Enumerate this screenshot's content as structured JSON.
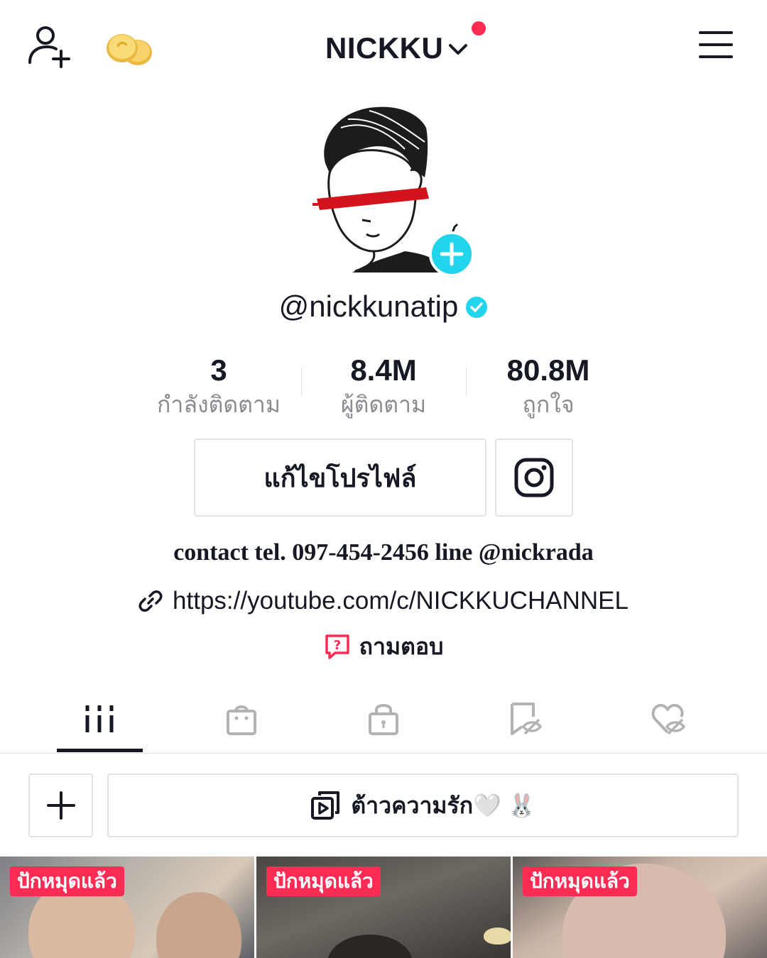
{
  "header": {
    "account_name": "NICKKU",
    "add_friend_icon": "person-add-icon",
    "coins_icon": "coins-icon",
    "menu_icon": "hamburger-menu-icon",
    "notification_color": "#fe2c55"
  },
  "profile": {
    "username": "@nickkunatip",
    "verified": true,
    "add_button_color": "#20d5ec"
  },
  "stats": [
    {
      "value": "3",
      "label": "กำลังติดตาม"
    },
    {
      "value": "8.4M",
      "label": "ผู้ติดตาม"
    },
    {
      "value": "80.8M",
      "label": "ถูกใจ"
    }
  ],
  "actions": {
    "edit_profile": "แก้ไขโปรไฟล์",
    "instagram_icon": "instagram-icon"
  },
  "bio": {
    "text": "contact tel. 097-454-2456 line @nickrada",
    "link": "https://youtube.com/c/NICKKUCHANNEL",
    "qa": "ถามตอบ"
  },
  "tabs": [
    {
      "icon": "grid-icon",
      "active": true
    },
    {
      "icon": "shopping-bag-icon",
      "active": false
    },
    {
      "icon": "lock-icon",
      "active": false
    },
    {
      "icon": "hidden-bookmark-icon",
      "active": false
    },
    {
      "icon": "hidden-heart-icon",
      "active": false
    }
  ],
  "playlist": {
    "title": "ต้าวความรัก🤍 🐰"
  },
  "videos": [
    {
      "badge": "ปักหมุดแล้ว"
    },
    {
      "badge": "ปักหมุดแล้ว"
    },
    {
      "badge": "ปักหมุดแล้ว"
    }
  ]
}
